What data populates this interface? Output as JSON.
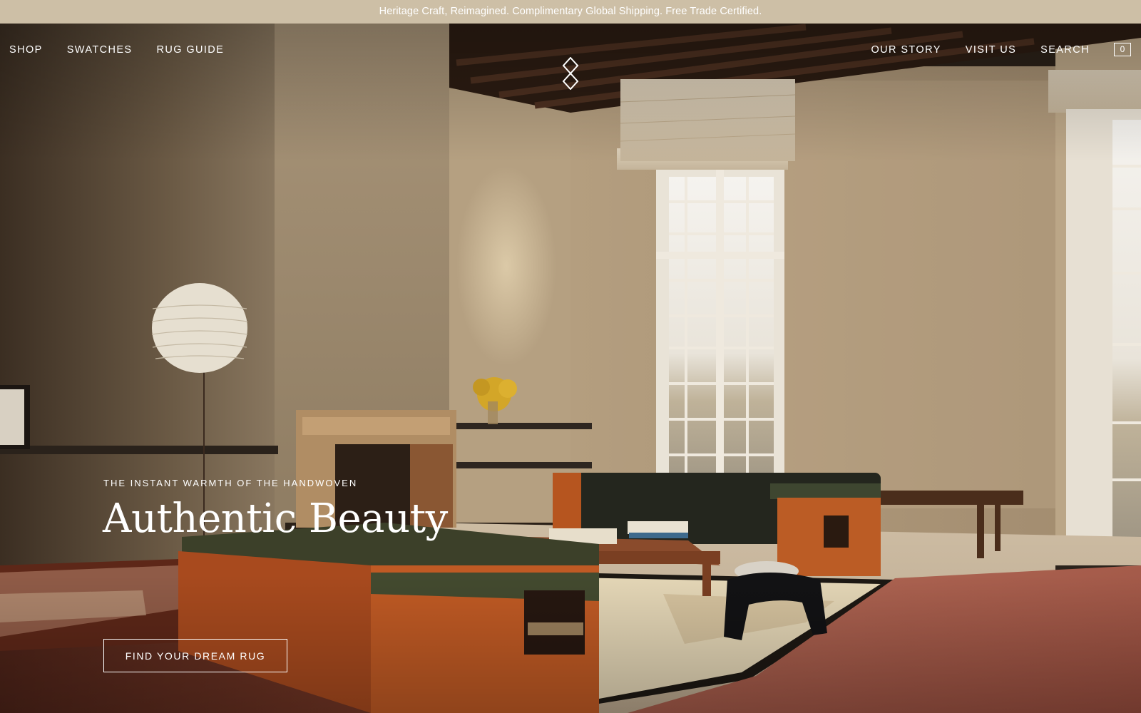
{
  "announcement": "Heritage Craft, Reimagined. Complimentary Global Shipping. Free Trade Certified.",
  "nav_left": [
    "SHOP",
    "SWATCHES",
    "RUG GUIDE"
  ],
  "nav_right": [
    "OUR STORY",
    "VISIT US",
    "SEARCH"
  ],
  "cart_count": "0",
  "hero": {
    "eyebrow": "THE INSTANT WARMTH OF THE HANDWOVEN",
    "headline": "Authentic Beauty",
    "cta_label": "FIND YOUR DREAM RUG"
  },
  "colors": {
    "announcement_bg": "#cdbfa6",
    "text": "#ffffff",
    "wall": "#b9a586",
    "rug_rust": "#a65a49",
    "sofa_wood": "#b8521f",
    "sofa_cushion": "#3c4029"
  },
  "icons": [
    "logo-icon",
    "cart-icon"
  ]
}
